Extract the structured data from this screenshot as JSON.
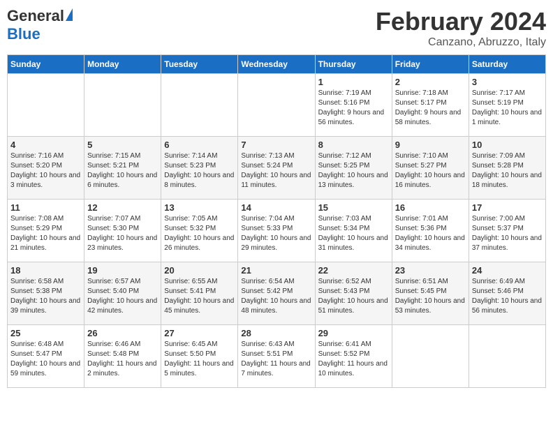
{
  "header": {
    "logo_general": "General",
    "logo_blue": "Blue",
    "title": "February 2024",
    "subtitle": "Canzano, Abruzzo, Italy"
  },
  "weekdays": [
    "Sunday",
    "Monday",
    "Tuesday",
    "Wednesday",
    "Thursday",
    "Friday",
    "Saturday"
  ],
  "weeks": [
    [
      {
        "day": "",
        "info": ""
      },
      {
        "day": "",
        "info": ""
      },
      {
        "day": "",
        "info": ""
      },
      {
        "day": "",
        "info": ""
      },
      {
        "day": "1",
        "info": "Sunrise: 7:19 AM\nSunset: 5:16 PM\nDaylight: 9 hours and 56 minutes."
      },
      {
        "day": "2",
        "info": "Sunrise: 7:18 AM\nSunset: 5:17 PM\nDaylight: 9 hours and 58 minutes."
      },
      {
        "day": "3",
        "info": "Sunrise: 7:17 AM\nSunset: 5:19 PM\nDaylight: 10 hours and 1 minute."
      }
    ],
    [
      {
        "day": "4",
        "info": "Sunrise: 7:16 AM\nSunset: 5:20 PM\nDaylight: 10 hours and 3 minutes."
      },
      {
        "day": "5",
        "info": "Sunrise: 7:15 AM\nSunset: 5:21 PM\nDaylight: 10 hours and 6 minutes."
      },
      {
        "day": "6",
        "info": "Sunrise: 7:14 AM\nSunset: 5:23 PM\nDaylight: 10 hours and 8 minutes."
      },
      {
        "day": "7",
        "info": "Sunrise: 7:13 AM\nSunset: 5:24 PM\nDaylight: 10 hours and 11 minutes."
      },
      {
        "day": "8",
        "info": "Sunrise: 7:12 AM\nSunset: 5:25 PM\nDaylight: 10 hours and 13 minutes."
      },
      {
        "day": "9",
        "info": "Sunrise: 7:10 AM\nSunset: 5:27 PM\nDaylight: 10 hours and 16 minutes."
      },
      {
        "day": "10",
        "info": "Sunrise: 7:09 AM\nSunset: 5:28 PM\nDaylight: 10 hours and 18 minutes."
      }
    ],
    [
      {
        "day": "11",
        "info": "Sunrise: 7:08 AM\nSunset: 5:29 PM\nDaylight: 10 hours and 21 minutes."
      },
      {
        "day": "12",
        "info": "Sunrise: 7:07 AM\nSunset: 5:30 PM\nDaylight: 10 hours and 23 minutes."
      },
      {
        "day": "13",
        "info": "Sunrise: 7:05 AM\nSunset: 5:32 PM\nDaylight: 10 hours and 26 minutes."
      },
      {
        "day": "14",
        "info": "Sunrise: 7:04 AM\nSunset: 5:33 PM\nDaylight: 10 hours and 29 minutes."
      },
      {
        "day": "15",
        "info": "Sunrise: 7:03 AM\nSunset: 5:34 PM\nDaylight: 10 hours and 31 minutes."
      },
      {
        "day": "16",
        "info": "Sunrise: 7:01 AM\nSunset: 5:36 PM\nDaylight: 10 hours and 34 minutes."
      },
      {
        "day": "17",
        "info": "Sunrise: 7:00 AM\nSunset: 5:37 PM\nDaylight: 10 hours and 37 minutes."
      }
    ],
    [
      {
        "day": "18",
        "info": "Sunrise: 6:58 AM\nSunset: 5:38 PM\nDaylight: 10 hours and 39 minutes."
      },
      {
        "day": "19",
        "info": "Sunrise: 6:57 AM\nSunset: 5:40 PM\nDaylight: 10 hours and 42 minutes."
      },
      {
        "day": "20",
        "info": "Sunrise: 6:55 AM\nSunset: 5:41 PM\nDaylight: 10 hours and 45 minutes."
      },
      {
        "day": "21",
        "info": "Sunrise: 6:54 AM\nSunset: 5:42 PM\nDaylight: 10 hours and 48 minutes."
      },
      {
        "day": "22",
        "info": "Sunrise: 6:52 AM\nSunset: 5:43 PM\nDaylight: 10 hours and 51 minutes."
      },
      {
        "day": "23",
        "info": "Sunrise: 6:51 AM\nSunset: 5:45 PM\nDaylight: 10 hours and 53 minutes."
      },
      {
        "day": "24",
        "info": "Sunrise: 6:49 AM\nSunset: 5:46 PM\nDaylight: 10 hours and 56 minutes."
      }
    ],
    [
      {
        "day": "25",
        "info": "Sunrise: 6:48 AM\nSunset: 5:47 PM\nDaylight: 10 hours and 59 minutes."
      },
      {
        "day": "26",
        "info": "Sunrise: 6:46 AM\nSunset: 5:48 PM\nDaylight: 11 hours and 2 minutes."
      },
      {
        "day": "27",
        "info": "Sunrise: 6:45 AM\nSunset: 5:50 PM\nDaylight: 11 hours and 5 minutes."
      },
      {
        "day": "28",
        "info": "Sunrise: 6:43 AM\nSunset: 5:51 PM\nDaylight: 11 hours and 7 minutes."
      },
      {
        "day": "29",
        "info": "Sunrise: 6:41 AM\nSunset: 5:52 PM\nDaylight: 11 hours and 10 minutes."
      },
      {
        "day": "",
        "info": ""
      },
      {
        "day": "",
        "info": ""
      }
    ]
  ]
}
